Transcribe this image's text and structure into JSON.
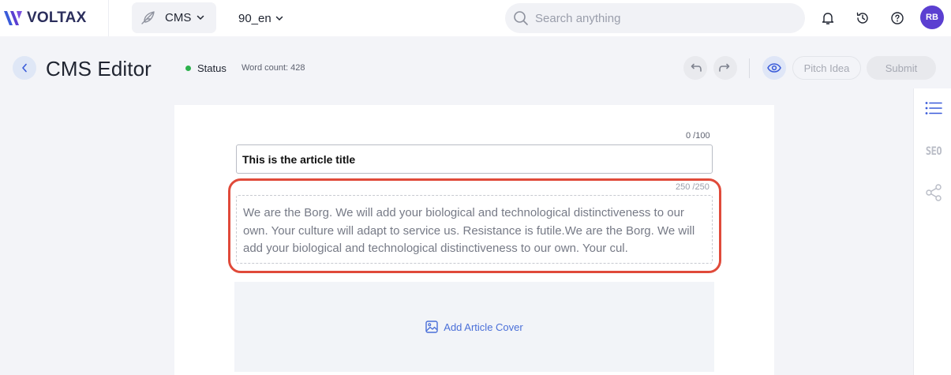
{
  "brand": {
    "name": "VOLTAX",
    "accent": "#5b3fd1"
  },
  "topnav": {
    "product_dropdown": {
      "label": "CMS",
      "icon": "feather-icon"
    },
    "locale_dropdown": {
      "label": "90_en"
    },
    "search": {
      "placeholder": "Search anything"
    },
    "icons": [
      "bell-icon",
      "history-icon",
      "help-icon"
    ],
    "user": {
      "initials": "RB"
    }
  },
  "header": {
    "title": "CMS Editor",
    "status_label": "Status",
    "status_color": "#2db14d",
    "word_count": "Word count: 428",
    "pitch_label": "Pitch Idea",
    "submit_label": "Submit"
  },
  "right_rail": {
    "items": [
      "list-icon",
      "SEO",
      "share-icon"
    ]
  },
  "editor": {
    "title_counter": "0 /100",
    "title_value": "This is the article title",
    "description_counter": "250 /250",
    "description_value": "We are the Borg. We will add your biological and technological distinctiveness to our own. Your culture will adapt to service us. Resistance is futile.We are the Borg. We will add your biological and technological distinctiveness to our own. Your cul.",
    "highlight_color": "#e04a3a",
    "cover_label": "Add Article Cover"
  }
}
